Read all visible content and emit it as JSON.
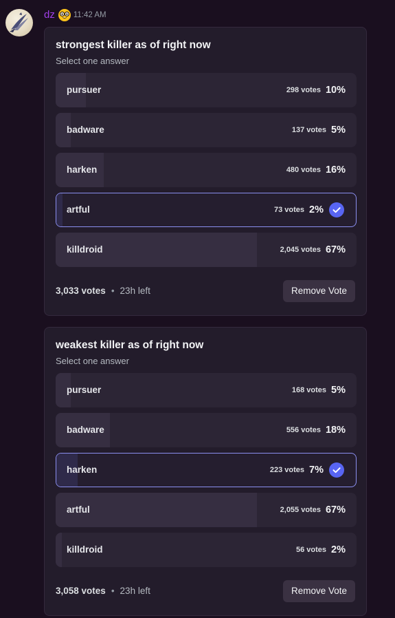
{
  "message": {
    "username": "dz",
    "emoji_icon": "nerd-face-icon",
    "timestamp": "11:42 AM",
    "colors": {
      "username": "#a040e8",
      "check_accent": "#5865f2",
      "selected_border": "#8b8ff0"
    }
  },
  "polls": [
    {
      "question": "strongest killer as of right now",
      "prompt": "Select one answer",
      "answers": [
        {
          "label": "pursuer",
          "votes": "298 votes",
          "percent": "10%",
          "fraction": 0.1,
          "selected": false
        },
        {
          "label": "badware",
          "votes": "137 votes",
          "percent": "5%",
          "fraction": 0.05,
          "selected": false
        },
        {
          "label": "harken",
          "votes": "480 votes",
          "percent": "16%",
          "fraction": 0.16,
          "selected": false
        },
        {
          "label": "artful",
          "votes": "73 votes",
          "percent": "2%",
          "fraction": 0.02,
          "selected": true
        },
        {
          "label": "killdroid",
          "votes": "2,045 votes",
          "percent": "67%",
          "fraction": 0.67,
          "selected": false
        }
      ],
      "total_votes": "3,033 votes",
      "separator": "•",
      "time_left": "23h left",
      "remove_vote_label": "Remove Vote"
    },
    {
      "question": "weakest killer as of right now",
      "prompt": "Select one answer",
      "answers": [
        {
          "label": "pursuer",
          "votes": "168 votes",
          "percent": "5%",
          "fraction": 0.05,
          "selected": false
        },
        {
          "label": "badware",
          "votes": "556 votes",
          "percent": "18%",
          "fraction": 0.18,
          "selected": false
        },
        {
          "label": "harken",
          "votes": "223 votes",
          "percent": "7%",
          "fraction": 0.07,
          "selected": true
        },
        {
          "label": "artful",
          "votes": "2,055 votes",
          "percent": "67%",
          "fraction": 0.67,
          "selected": false
        },
        {
          "label": "killdroid",
          "votes": "56 votes",
          "percent": "2%",
          "fraction": 0.02,
          "selected": false
        }
      ],
      "total_votes": "3,058 votes",
      "separator": "•",
      "time_left": "23h left",
      "remove_vote_label": "Remove Vote"
    }
  ]
}
